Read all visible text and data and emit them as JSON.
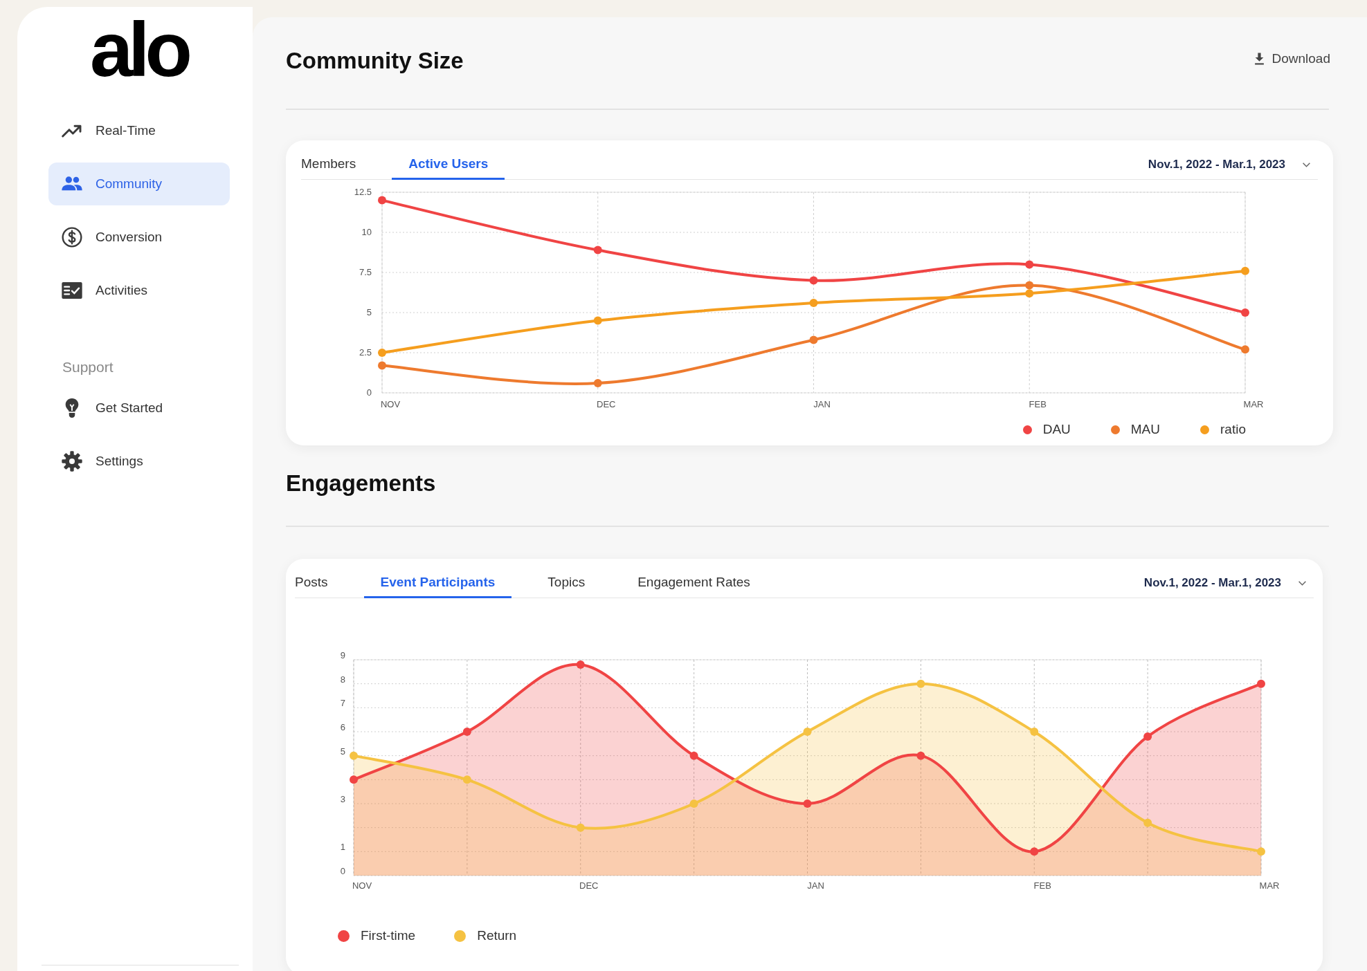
{
  "logo": "alo",
  "nav": [
    {
      "label": "Real-Time",
      "selected": false
    },
    {
      "label": "Community",
      "selected": true
    },
    {
      "label": "Conversion",
      "selected": false
    },
    {
      "label": "Activities",
      "selected": false
    }
  ],
  "support": {
    "title": "Support",
    "items": [
      {
        "label": "Get Started",
        "selected": false
      },
      {
        "label": "Settings",
        "selected": false
      }
    ]
  },
  "community_size": {
    "title": "Community Size",
    "download": "Download",
    "card": {
      "tabs": [
        {
          "label": "Members",
          "selected": false
        },
        {
          "label": "Active Users",
          "selected": true
        }
      ],
      "date_range": "Nov.1, 2022 - Mar.1, 2023",
      "chart_data": {
        "type": "line",
        "grid": true,
        "categories": [
          "NOV",
          "DEC",
          "JAN",
          "FEB",
          "MAR"
        ],
        "ylim": [
          0,
          12.5
        ],
        "yticks": [
          0,
          2.5,
          5,
          7.5,
          10,
          12.5
        ],
        "series": [
          {
            "name": "DAU",
            "color": "#f04444",
            "marker": true,
            "values": [
              12,
              8.9,
              7,
              8,
              5
            ]
          },
          {
            "name": "MAU",
            "color": "#ee7a2e",
            "marker": true,
            "values": [
              1.7,
              0.6,
              3.3,
              6.7,
              2.7
            ]
          },
          {
            "name": "ratio",
            "color": "#f59e1e",
            "marker": true,
            "values": [
              2.5,
              4.5,
              5.6,
              6.2,
              7.6
            ]
          }
        ]
      }
    }
  },
  "engagements": {
    "title": "Engagements",
    "card": {
      "tabs": [
        {
          "label": "Posts",
          "selected": false
        },
        {
          "label": "Event Participants",
          "selected": true
        },
        {
          "label": "Topics",
          "selected": false
        },
        {
          "label": "Engagement Rates",
          "selected": false
        }
      ],
      "date_range": "Nov.1, 2022 - Mar.1, 2023",
      "chart_data": {
        "type": "area",
        "grid": true,
        "categories": [
          "NOV",
          null,
          "DEC",
          null,
          "JAN",
          null,
          "FEB",
          null,
          "MAR"
        ],
        "ylim": [
          0,
          9
        ],
        "yticks": [
          0,
          1,
          3,
          5,
          6,
          7,
          8,
          9
        ],
        "series": [
          {
            "name": "First-time",
            "color": "#f04444",
            "marker": true,
            "values": [
              4,
              6,
              8.8,
              5,
              3,
              5,
              1,
              5.8,
              8
            ]
          },
          {
            "name": "Return",
            "color": "#f5c242",
            "marker": true,
            "values": [
              5,
              4,
              2,
              3,
              6,
              8,
              6,
              2.2,
              1
            ]
          }
        ]
      }
    }
  }
}
